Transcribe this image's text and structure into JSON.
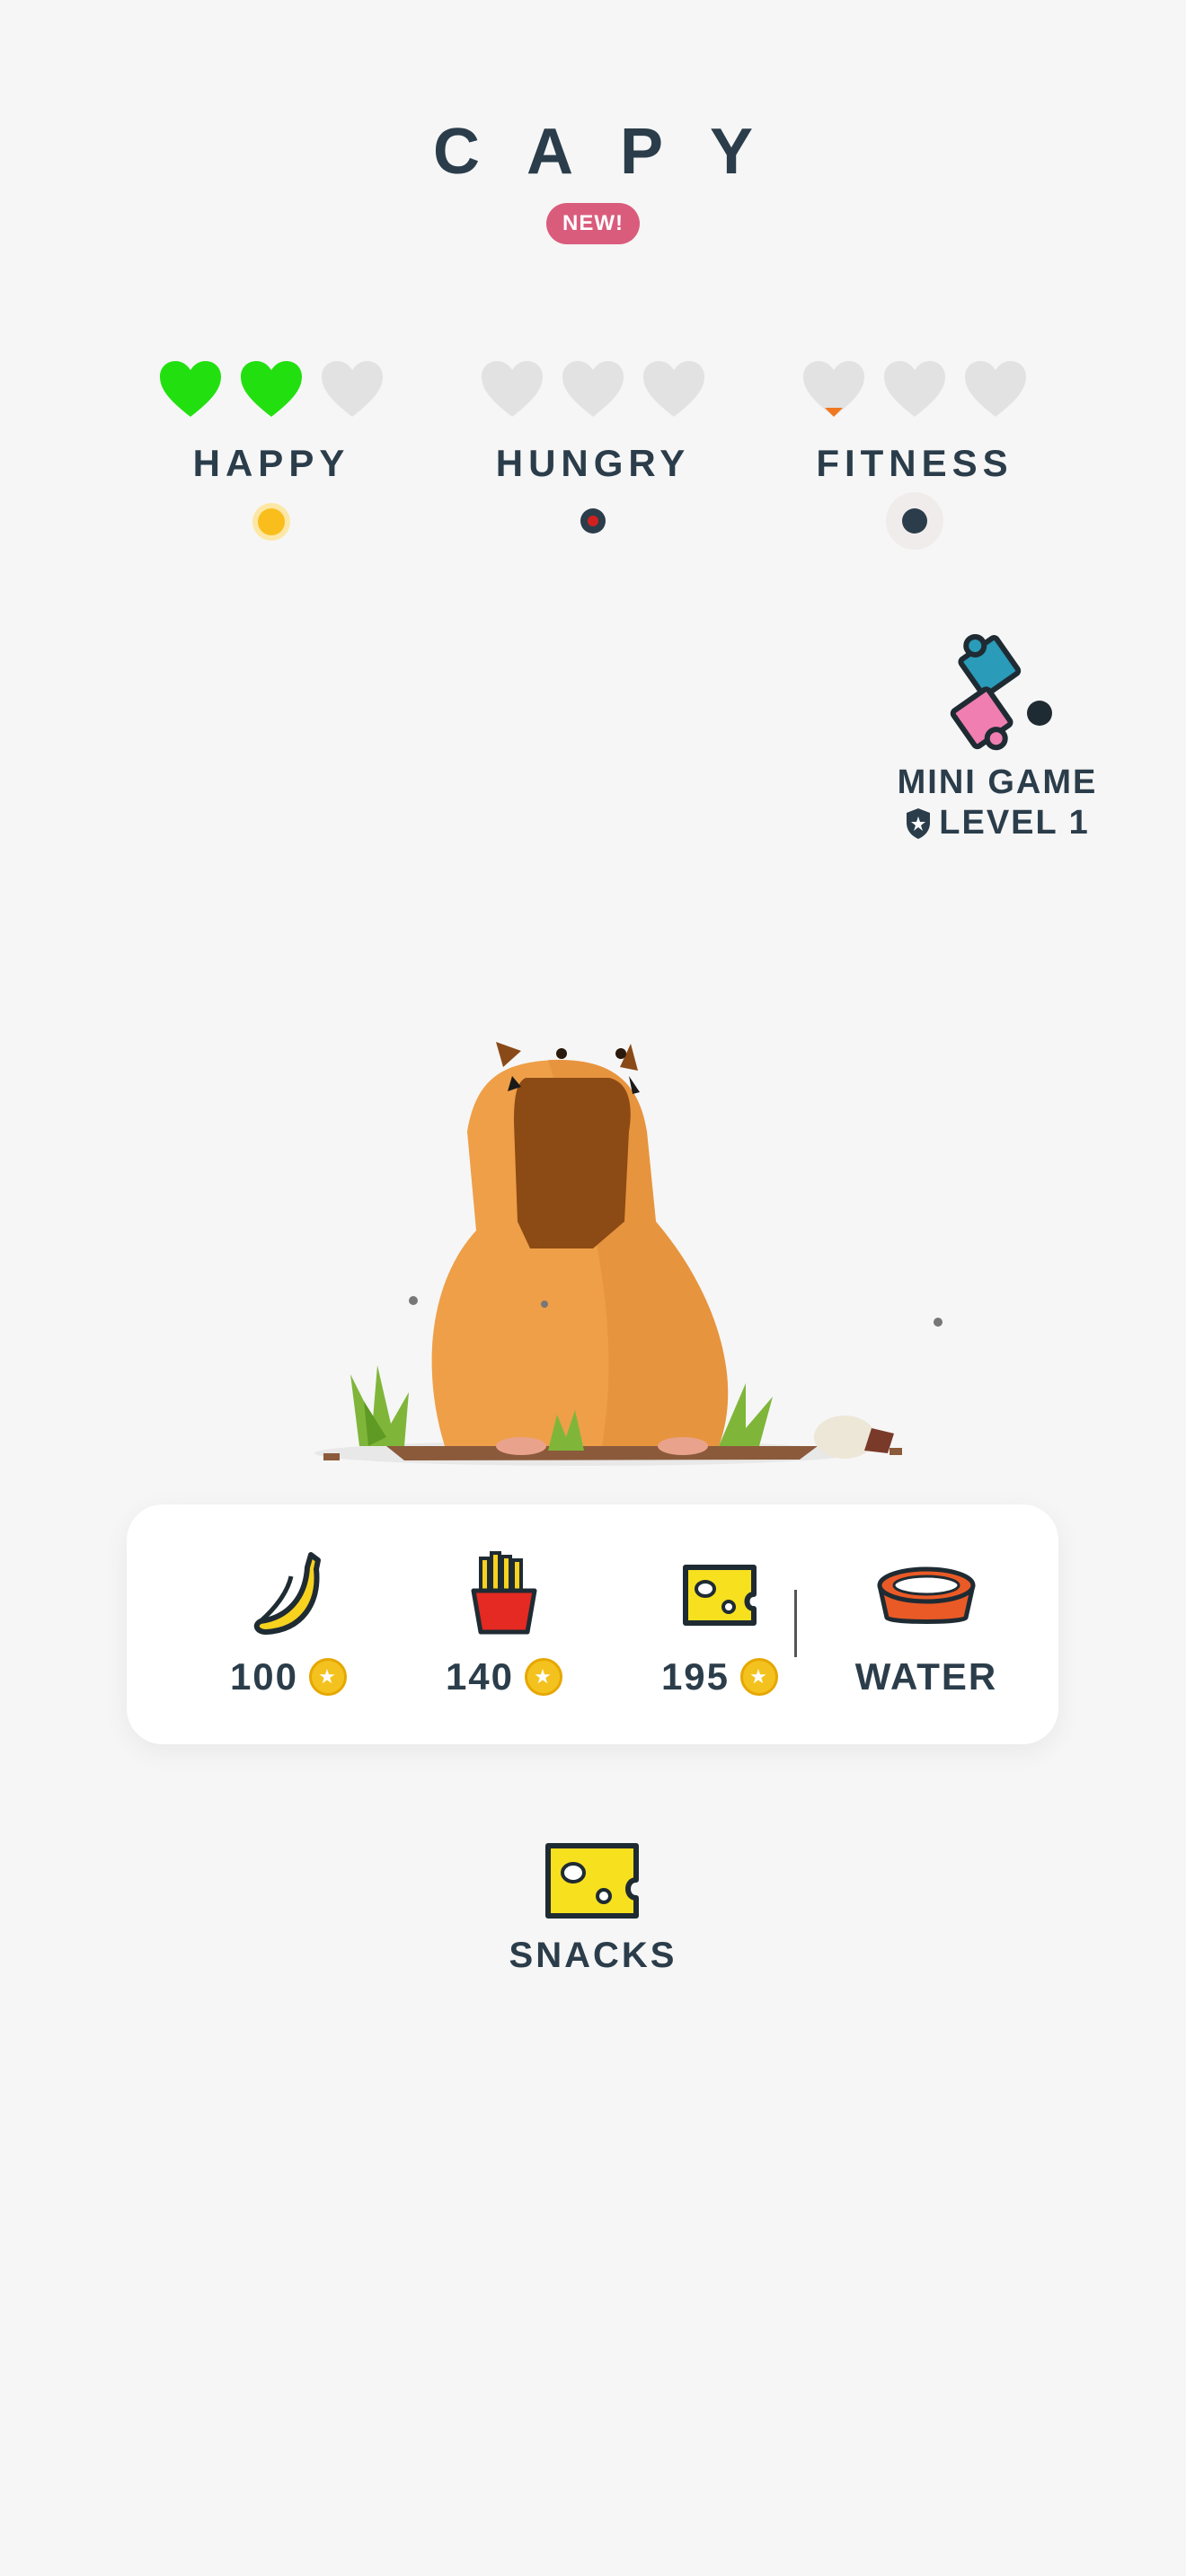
{
  "app": {
    "title": "CAPY",
    "badge": "NEW!"
  },
  "stats": [
    {
      "label": "HAPPY",
      "hearts_filled": 2,
      "hearts_total": 3,
      "indicator_color": "#f9bd1c"
    },
    {
      "label": "HUNGRY",
      "hearts_filled": 0,
      "hearts_total": 3,
      "indicator_color": "#d12020"
    },
    {
      "label": "FITNESS",
      "hearts_filled": 0,
      "hearts_total": 3,
      "indicator_color": "#2b3d4a"
    }
  ],
  "minigame": {
    "label": "MINI GAME",
    "level": "LEVEL 1",
    "icon": "puzzle-icon"
  },
  "food": [
    {
      "name": "banana",
      "icon": "banana-icon",
      "price": "100"
    },
    {
      "name": "fries",
      "icon": "fries-icon",
      "price": "140"
    },
    {
      "name": "cheese",
      "icon": "cheese-icon",
      "price": "195"
    },
    {
      "name": "water",
      "icon": "water-bowl-icon",
      "label": "WATER"
    }
  ],
  "snacks": {
    "label": "SNACKS",
    "icon": "cheese-icon"
  },
  "colors": {
    "heart_filled": "#22e010",
    "heart_empty": "#e2e2e2",
    "text": "#2b3d4a",
    "badge": "#d95c7c",
    "coin": "#f4c21f"
  }
}
